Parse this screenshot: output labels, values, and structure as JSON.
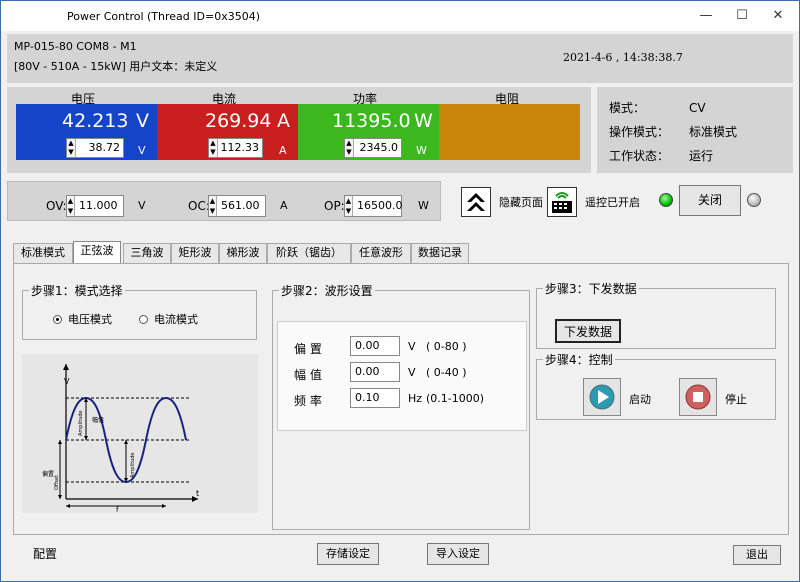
{
  "window": {
    "title": "Power Control (Thread ID=0x3504)",
    "min": "—",
    "max": "☐",
    "close": "✕"
  },
  "header": {
    "line1": "MP-015-80 COM8 - M1",
    "line2": "[80V - 510A - 15kW] 用户文本：未定义",
    "datetime": "2021-4-6 ,  14:38:38.7"
  },
  "meters": {
    "voltage": {
      "label": "电压",
      "value": "42.213",
      "unit": "V",
      "set": "38.72",
      "set_unit": "V",
      "color": "#1444c8"
    },
    "current": {
      "label": "电流",
      "value": "269.94",
      "unit": "A",
      "set": "112.33",
      "set_unit": "A",
      "color": "#c81e1e"
    },
    "power": {
      "label": "功率",
      "value": "11395.0",
      "unit": "W",
      "set": "2345.0",
      "set_unit": "W",
      "color": "#3cb81e"
    },
    "resistance": {
      "label": "电阻",
      "color": "#c8860a"
    }
  },
  "status": {
    "mode_label": "模式：",
    "mode_value": "CV",
    "opmode_label": "操作模式：",
    "opmode_value": "标准模式",
    "work_label": "工作状态：",
    "work_value": "运行"
  },
  "protection": {
    "ov_label": "OV:",
    "ov_value": "11.000",
    "ov_unit": "V",
    "oc_label": "OC:",
    "oc_value": "561.00",
    "oc_unit": "A",
    "op_label": "OP:",
    "op_value": "16500.0",
    "op_unit": "W"
  },
  "controls": {
    "hide_page": "隐藏页面",
    "remote_on": "遥控已开启",
    "close_btn": "关闭"
  },
  "tabs": [
    "标准模式",
    "正弦波",
    "三角波",
    "矩形波",
    "梯形波",
    "阶跃（锯齿）",
    "任意波形",
    "数据记录"
  ],
  "step1": {
    "title": "步骤1：模式选择",
    "voltage_mode": "电压模式",
    "current_mode": "电流模式"
  },
  "diagram": {
    "v": "V",
    "t": "t",
    "f": "f",
    "amplitude": "Amplitude",
    "fuzhi": "幅值",
    "offset": "Offset",
    "pianzhi": "偏置"
  },
  "step2": {
    "title": "步骤2：波形设置",
    "offset_label": "偏 置",
    "offset_value": "0.00",
    "offset_unit": "V",
    "offset_range": "( 0-80 )",
    "amp_label": "幅 值",
    "amp_value": "0.00",
    "amp_unit": "V",
    "amp_range": "( 0-40 )",
    "freq_label": "频 率",
    "freq_value": "0.10",
    "freq_unit": "Hz",
    "freq_range": "(0.1-1000)"
  },
  "step3": {
    "title": "步骤3：下发数据",
    "button": "下发数据"
  },
  "step4": {
    "title": "步骤4：控制",
    "start": "启动",
    "stop": "停止"
  },
  "footer": {
    "config": "配置",
    "save": "存储设定",
    "load": "导入设定",
    "exit": "退出"
  }
}
